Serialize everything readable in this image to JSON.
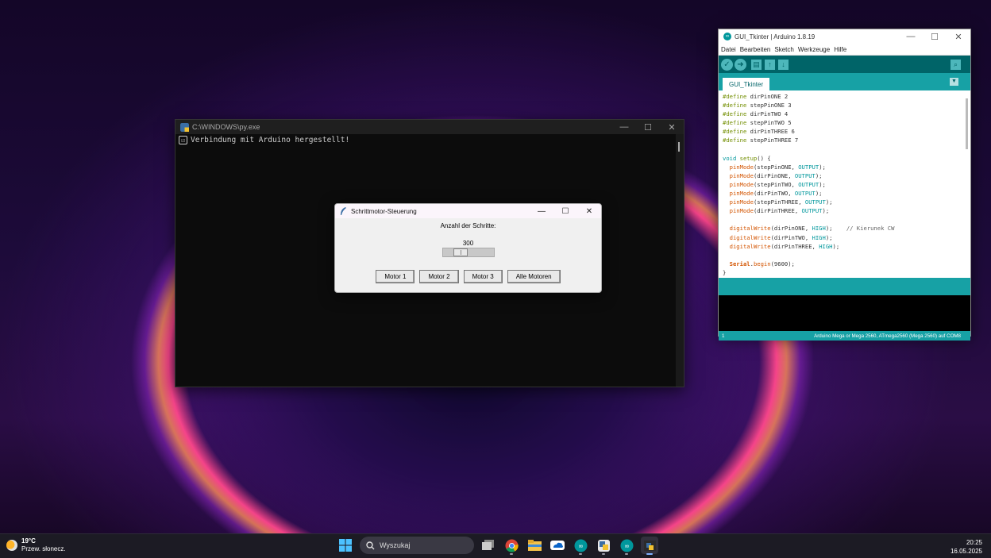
{
  "console": {
    "title": "C:\\WINDOWS\\py.exe",
    "check": "☑",
    "output": "Verbindung mit Arduino hergestellt!"
  },
  "tk": {
    "title": "Schrittmotor-Steuerung",
    "label": "Anzahl der Schritte:",
    "slider_value": "300",
    "buttons": [
      "Motor 1",
      "Motor 2",
      "Motor 3",
      "Alle Motoren"
    ]
  },
  "arduino": {
    "title": "GUI_Tkinter | Arduino 1.8.19",
    "menu": [
      "Datei",
      "Bearbeiten",
      "Sketch",
      "Werkzeuge",
      "Hilfe"
    ],
    "tab": "GUI_Tkinter",
    "line_number": "1",
    "board": "Arduino Mega or Mega 2560, ATmega2560 (Mega 2560) auf COM8"
  },
  "window_buttons": {
    "minimize": "—",
    "maximize": "☐",
    "close": "✕"
  },
  "taskbar": {
    "temperature": "19°C",
    "weather": "Przew. słonecz.",
    "search_placeholder": "Wyszukaj",
    "time": "20:25",
    "date": "16.05.2025"
  },
  "colors": {
    "arduino_teal": "#17a1a5",
    "arduino_dark": "#006468",
    "console_bg": "#0c0c0c"
  }
}
